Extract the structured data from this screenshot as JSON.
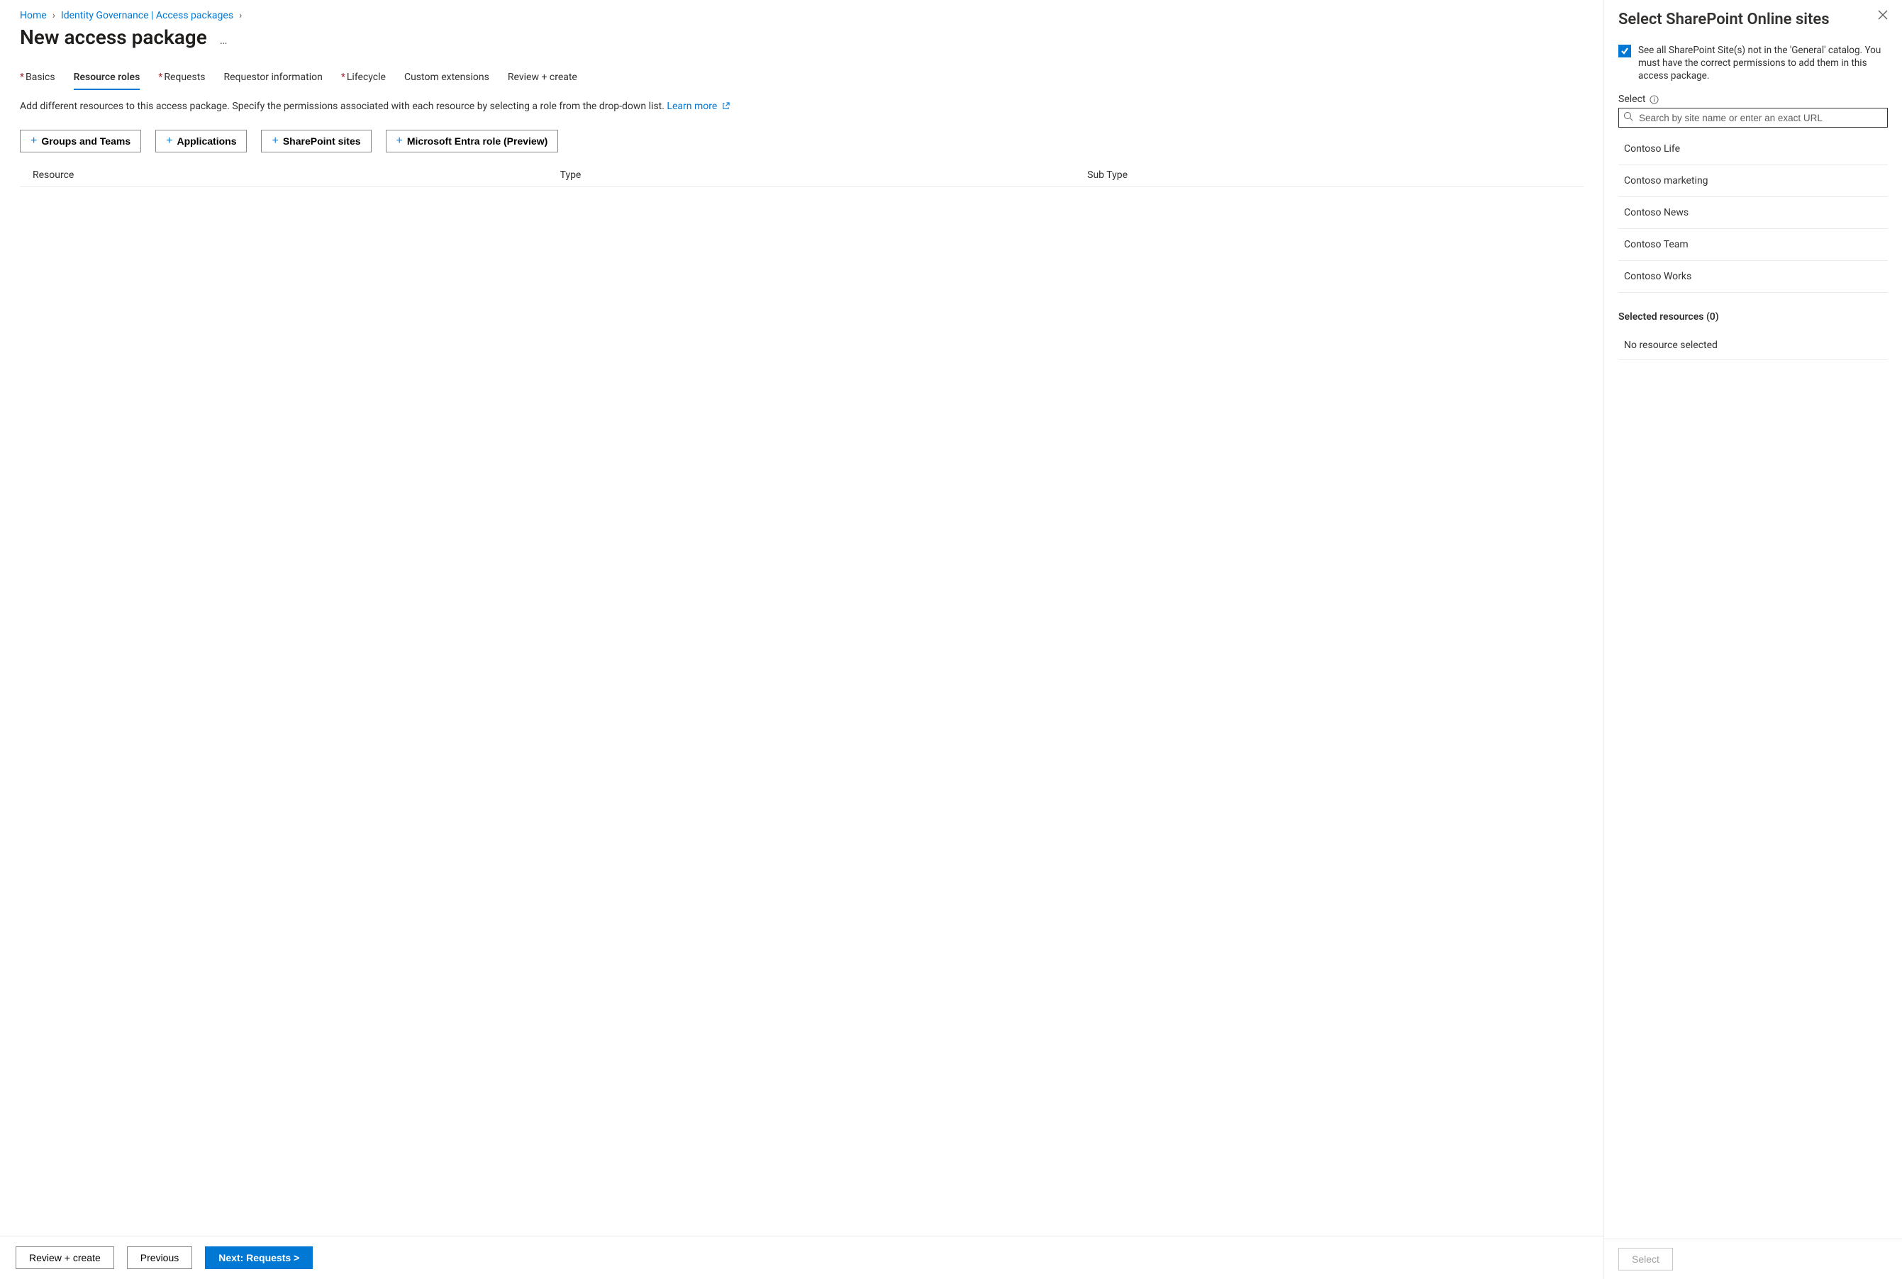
{
  "breadcrumb": {
    "items": [
      {
        "label": "Home"
      },
      {
        "label": "Identity Governance | Access packages"
      }
    ]
  },
  "page": {
    "title": "New access package"
  },
  "tabs": [
    {
      "label": "Basics",
      "required": true,
      "active": false
    },
    {
      "label": "Resource roles",
      "required": false,
      "active": true
    },
    {
      "label": "Requests",
      "required": true,
      "active": false
    },
    {
      "label": "Requestor information",
      "required": false,
      "active": false
    },
    {
      "label": "Lifecycle",
      "required": true,
      "active": false
    },
    {
      "label": "Custom extensions",
      "required": false,
      "active": false
    },
    {
      "label": "Review + create",
      "required": false,
      "active": false
    }
  ],
  "description": {
    "text": "Add different resources to this access package. Specify the permissions associated with each resource by selecting a role from the drop-down list. ",
    "link_label": "Learn more"
  },
  "add_buttons": [
    {
      "label": "Groups and Teams"
    },
    {
      "label": "Applications"
    },
    {
      "label": "SharePoint sites"
    },
    {
      "label": "Microsoft Entra role (Preview)"
    }
  ],
  "columns": {
    "resource": "Resource",
    "type": "Type",
    "subtype": "Sub Type"
  },
  "footer": {
    "review": "Review + create",
    "previous": "Previous",
    "next": "Next: Requests >"
  },
  "panel": {
    "title": "Select SharePoint Online sites",
    "checkbox_label": "See all SharePoint Site(s) not in the 'General' catalog. You must have the correct permissions to add them in this access package.",
    "select_label": "Select",
    "search_placeholder": "Search by site name or enter an exact URL",
    "sites": [
      {
        "name": "Contoso Life"
      },
      {
        "name": "Contoso marketing"
      },
      {
        "name": "Contoso News"
      },
      {
        "name": "Contoso Team"
      },
      {
        "name": "Contoso Works"
      }
    ],
    "selected_header": "Selected resources (0)",
    "selected_empty": "No resource selected",
    "select_button": "Select"
  }
}
